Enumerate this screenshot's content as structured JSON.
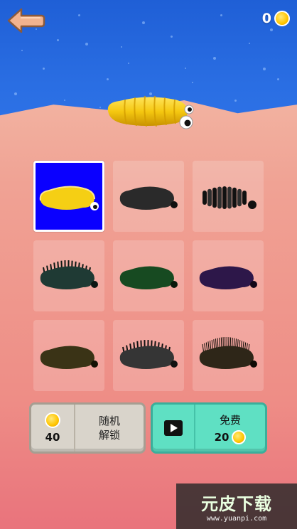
{
  "header": {
    "coin_count": "0",
    "back_icon": "back-arrow-icon",
    "coin_icon": "gold-coin-icon"
  },
  "colors": {
    "sea": "#2a6ee3",
    "sand": "#f0998a",
    "selected_tile": "#0a00ff",
    "random_button": "#d9d4cb",
    "free_button": "#5fe0c3",
    "coin": "#ffc500"
  },
  "skins": [
    {
      "id": "yellow-worm",
      "selected": true,
      "body": "#f5cf14",
      "shade": "#d9a800"
    },
    {
      "id": "dark-smooth-worm",
      "selected": false,
      "body": "#2a2a2a",
      "shade": "#111111"
    },
    {
      "id": "ribbed-worm",
      "selected": false,
      "body": "#2e2e2e",
      "shade": "#111111"
    },
    {
      "id": "spiky-teal-worm",
      "selected": false,
      "body": "#1f3a34",
      "shade": "#0c1713"
    },
    {
      "id": "green-worm",
      "selected": false,
      "body": "#174a21",
      "shade": "#0a1a0c"
    },
    {
      "id": "purple-worm",
      "selected": false,
      "body": "#2d1749",
      "shade": "#120818"
    },
    {
      "id": "brown-worm",
      "selected": false,
      "body": "#3a3316",
      "shade": "#151205"
    },
    {
      "id": "grey-spiky-worm",
      "selected": false,
      "body": "#353535",
      "shade": "#121212"
    },
    {
      "id": "hairy-worm",
      "selected": false,
      "body": "#2e2618",
      "shade": "#0f0c06"
    }
  ],
  "random_unlock": {
    "price": "40",
    "line1": "随机",
    "line2": "解锁"
  },
  "free": {
    "label": "免费",
    "reward": "20",
    "icon": "video-play-icon"
  },
  "watermark": {
    "logo": "元皮下载",
    "url": "www.yuanpi.com"
  }
}
